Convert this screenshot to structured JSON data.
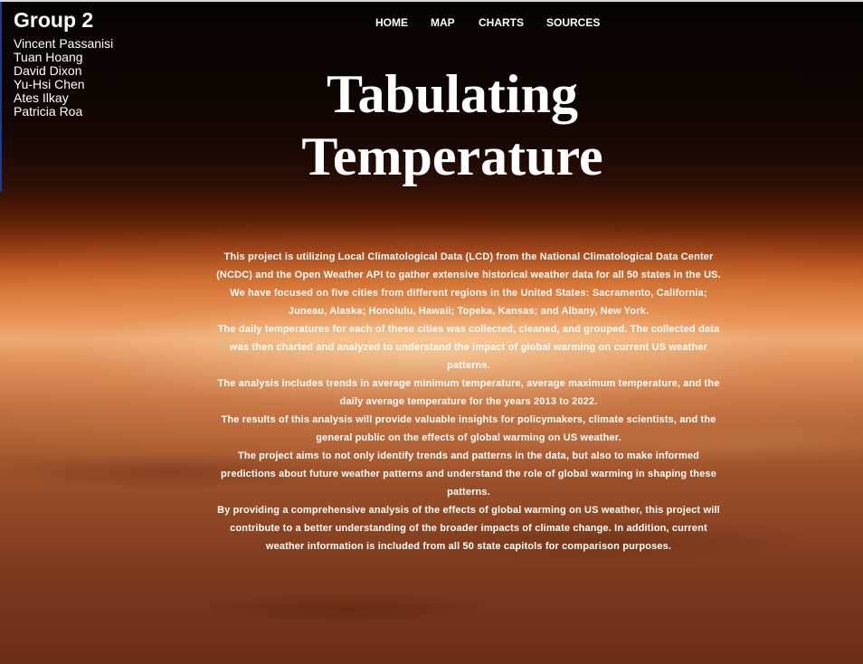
{
  "header": {
    "group_title": "Group 2",
    "members": [
      "Vincent Passanisi",
      "Tuan Hoang",
      "David Dixon",
      "Yu-Hsi Chen",
      "Ates Ilkay",
      "Patricia Roa"
    ]
  },
  "nav": {
    "items": [
      {
        "label": "HOME"
      },
      {
        "label": "MAP"
      },
      {
        "label": "CHARTS"
      },
      {
        "label": "SOURCES"
      }
    ]
  },
  "hero": {
    "title_line1": "Tabulating",
    "title_line2": "Temperature"
  },
  "content": {
    "paragraphs": [
      "This project is utilizing Local Climatological Data (LCD) from the National Climatological Data Center (NCDC) and the Open Weather API to gather extensive historical weather data for all 50 states in the US. We have focused on five cities from different regions in the United States: Sacramento, California; Juneau, Alaska; Honolulu, Hawaii; Topeka, Kansas; and Albany, New York.",
      "The daily temperatures for each of these cities was collected, cleaned, and grouped. The collected data was then charted and analyzed to understand the impact of global warming on current US weather patterns.",
      "The analysis includes trends in average minimum temperature, average maximum temperature, and the daily average temperature for the years 2013 to 2022.",
      "The results of this analysis will provide valuable insights for policymakers, climate scientists, and the general public on the effects of global warming on US weather.",
      "The project aims to not only identify trends and patterns in the data, but also to make informed predictions about future weather patterns and understand the role of global warming in shaping these patterns.",
      "By providing a comprehensive analysis of the effects of global warming on US weather, this project will contribute to a better understanding of the broader impacts of climate change. In addition, current weather information is included from all 50 state capitols for comparison purposes."
    ]
  },
  "colors": {
    "text": "#ffffff",
    "sky_dark": "#070301",
    "horizon_glow": "#f0b27e",
    "surface": "#934a26"
  }
}
